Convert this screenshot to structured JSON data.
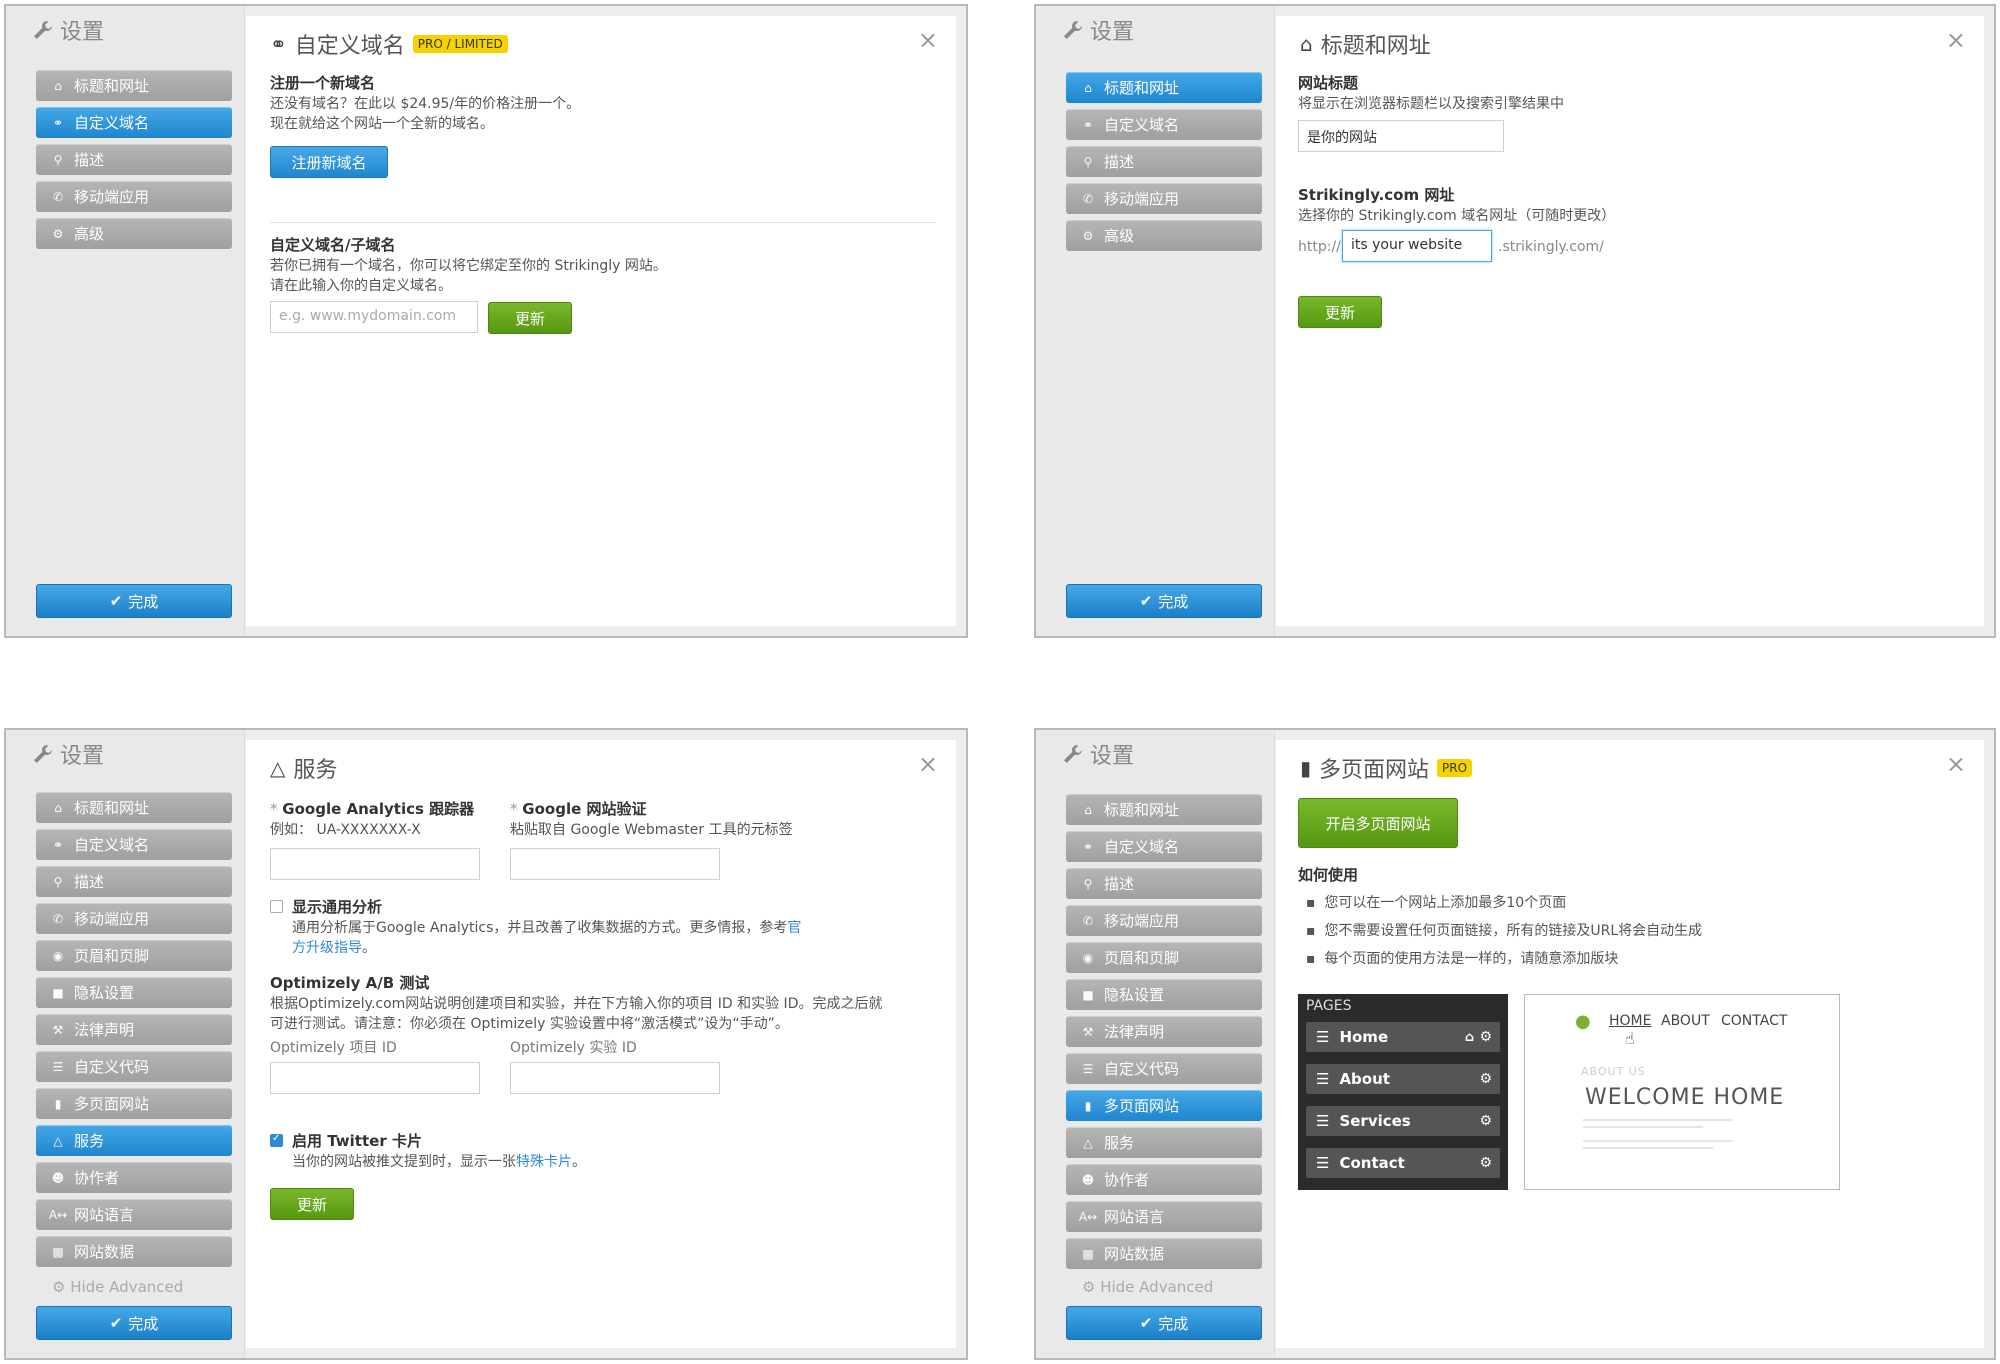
{
  "panel1": {
    "sidebar": {
      "title": "设置",
      "items": [
        {
          "label": "标题和网址",
          "icon": "home-icon"
        },
        {
          "label": "自定义域名",
          "icon": "link-icon"
        },
        {
          "label": "描述",
          "icon": "search-icon"
        },
        {
          "label": "移动端应用",
          "icon": "phone-icon"
        },
        {
          "label": "高级",
          "icon": "gears-icon"
        }
      ],
      "active": "自定义域名",
      "done": "完成"
    },
    "title": "自定义域名",
    "badge": "PRO / LIMITED",
    "register": {
      "heading": "注册一个新域名",
      "line1": "还没有域名？在此以 $24.95/年的价格注册一个。",
      "line2": "现在就给这个网站一个全新的域名。",
      "button": "注册新域名"
    },
    "custom": {
      "heading": "自定义域名/子域名",
      "line1": "若你已拥有一个域名，你可以将它绑定至你的 Strikingly 网站。",
      "line2": "请在此输入你的自定义域名。",
      "placeholder": "e.g. www.mydomain.com",
      "button": "更新"
    }
  },
  "panel2": {
    "sidebar": {
      "title": "设置",
      "items": [
        {
          "label": "标题和网址",
          "icon": "home-icon"
        },
        {
          "label": "自定义域名",
          "icon": "link-icon"
        },
        {
          "label": "描述",
          "icon": "search-icon"
        },
        {
          "label": "移动端应用",
          "icon": "phone-icon"
        },
        {
          "label": "高级",
          "icon": "gears-icon"
        }
      ],
      "active": "标题和网址",
      "done": "完成"
    },
    "title": "标题和网址",
    "site_title": {
      "heading": "网站标题",
      "desc": "将显示在浏览器标题栏以及搜索引擎结果中",
      "value": "是你的网站"
    },
    "url": {
      "heading": "Strikingly.com 网址",
      "desc": "选择你的 Strikingly.com 域名网址（可随时更改）",
      "prefix": "http://",
      "value": "its your website",
      "suffix": ".strikingly.com/"
    },
    "button": "更新"
  },
  "panel3": {
    "sidebar": {
      "title": "设置",
      "items": [
        {
          "label": "标题和网址",
          "icon": "home-icon"
        },
        {
          "label": "自定义域名",
          "icon": "link-icon"
        },
        {
          "label": "描述",
          "icon": "search-icon"
        },
        {
          "label": "移动端应用",
          "icon": "phone-icon"
        },
        {
          "label": "页眉和页脚",
          "icon": "eye-icon"
        },
        {
          "label": "隐私设置",
          "icon": "lock-icon"
        },
        {
          "label": "法律声明",
          "icon": "gavel-icon"
        },
        {
          "label": "自定义代码",
          "icon": "list-icon"
        },
        {
          "label": "多页面网站",
          "icon": "file-icon"
        },
        {
          "label": "服务",
          "icon": "flask-icon"
        },
        {
          "label": "协作者",
          "icon": "users-icon"
        },
        {
          "label": "网站语言",
          "icon": "translate-icon"
        },
        {
          "label": "网站数据",
          "icon": "bar-chart-icon"
        }
      ],
      "active": "服务",
      "hide_advanced": "Hide Advanced",
      "done": "完成"
    },
    "title": "服务",
    "ga": {
      "heading": "Google Analytics 跟踪器",
      "example": "例如： UA-XXXXXXX-X"
    },
    "gv": {
      "heading": "Google 网站验证",
      "desc": "粘贴取自 Google Webmaster 工具的元标签"
    },
    "universal": {
      "label": "显示通用分析",
      "desc": "通用分析属于Google Analytics，并且改善了收集数据的方式。更多情报，参考",
      "link_a": "官",
      "link_b": "方升级指导",
      "end": "。"
    },
    "optimizely": {
      "heading": "Optimizely A/B 测试",
      "line1": "根据Optimizely.com网站说明创建项目和实验，并在下方输入你的项目 ID 和实验 ID。完成之后就",
      "line2": "可进行测试。请注意：你必须在 Optimizely 实验设置中将“激活模式”设为“手动”。",
      "project_label": "Optimizely 项目 ID",
      "experiment_label": "Optimizely 实验 ID"
    },
    "twitter": {
      "label": "启用 Twitter 卡片",
      "desc": "当你的网站被推文提到时，显示一张",
      "link": "特殊卡片",
      "end": "。",
      "checked": true
    },
    "universal_checked": false,
    "button": "更新"
  },
  "panel4": {
    "sidebar": {
      "title": "设置",
      "items": [
        {
          "label": "标题和网址",
          "icon": "home-icon"
        },
        {
          "label": "自定义域名",
          "icon": "link-icon"
        },
        {
          "label": "描述",
          "icon": "search-icon"
        },
        {
          "label": "移动端应用",
          "icon": "phone-icon"
        },
        {
          "label": "页眉和页脚",
          "icon": "eye-icon"
        },
        {
          "label": "隐私设置",
          "icon": "lock-icon"
        },
        {
          "label": "法律声明",
          "icon": "gavel-icon"
        },
        {
          "label": "自定义代码",
          "icon": "list-icon"
        },
        {
          "label": "多页面网站",
          "icon": "file-icon"
        },
        {
          "label": "服务",
          "icon": "flask-icon"
        },
        {
          "label": "协作者",
          "icon": "users-icon"
        },
        {
          "label": "网站语言",
          "icon": "translate-icon"
        },
        {
          "label": "网站数据",
          "icon": "bar-chart-icon"
        }
      ],
      "active": "多页面网站",
      "hide_advanced": "Hide Advanced",
      "done": "完成"
    },
    "title": "多页面网站",
    "badge": "PRO",
    "enable_button": "开启多页面网站",
    "howto": "如何使用",
    "bullets": [
      "您可以在一个网站上添加最多10个页面",
      "您不需要设置任何页面链接，所有的链接及URL将会自动生成",
      "每个页面的使用方法是一样的，请随意添加版块"
    ],
    "pages_header": "PAGES",
    "pages": [
      "Home",
      "About",
      "Services",
      "Contact"
    ],
    "preview": {
      "nav": [
        "HOME",
        "ABOUT",
        "CONTACT"
      ],
      "about_us": "ABOUT US",
      "welcome": "WELCOME HOME"
    }
  },
  "colors": {
    "active": "#2a93dc",
    "green": "#6aab1f",
    "badge": "#f5d300",
    "link": "#2d8ad8"
  }
}
